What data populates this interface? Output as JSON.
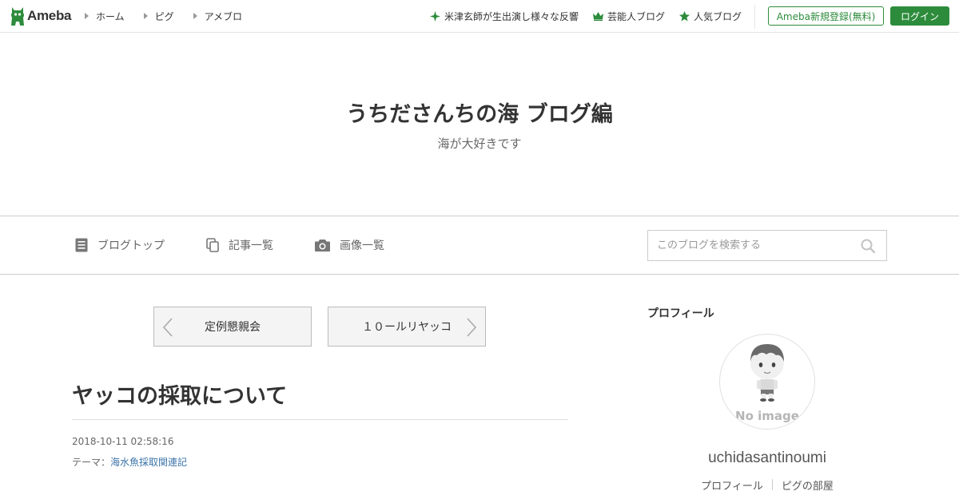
{
  "header": {
    "logo_text": "Ameba",
    "nav": [
      {
        "label": "ホーム"
      },
      {
        "label": "ピグ"
      },
      {
        "label": "アメブロ"
      }
    ],
    "promos": [
      {
        "label": "米津玄師が生出演し様々な反響",
        "icon": "sparkle-icon"
      },
      {
        "label": "芸能人ブログ",
        "icon": "crown-icon"
      },
      {
        "label": "人気ブログ",
        "icon": "star-icon"
      }
    ],
    "register_label": "Ameba新規登録(無料)",
    "login_label": "ログイン"
  },
  "blog": {
    "title": "うちださんちの海 ブログ編",
    "description": "海が大好きです"
  },
  "blog_nav": {
    "items": [
      {
        "label": "ブログトップ",
        "icon": "document-icon"
      },
      {
        "label": "記事一覧",
        "icon": "copy-icon"
      },
      {
        "label": "画像一覧",
        "icon": "camera-icon"
      }
    ],
    "search_placeholder": "このブログを検索する"
  },
  "entry_nav": {
    "prev_label": "定例懇親会",
    "next_label": "１０ールリヤッコ"
  },
  "entry": {
    "title": "ヤッコの採取について",
    "date": "2018-10-11 02:58:16",
    "theme_prefix": "テーマ：",
    "theme_label": "海水魚採取関連記"
  },
  "sidebar": {
    "heading": "プロフィール",
    "avatar_label": "No image",
    "username": "uchidasantinoumi",
    "links": [
      {
        "label": "プロフィール"
      },
      {
        "label": "ピグの部屋"
      }
    ]
  },
  "colors": {
    "brand_green": "#2d8c3c",
    "link_blue": "#3c74a8"
  }
}
